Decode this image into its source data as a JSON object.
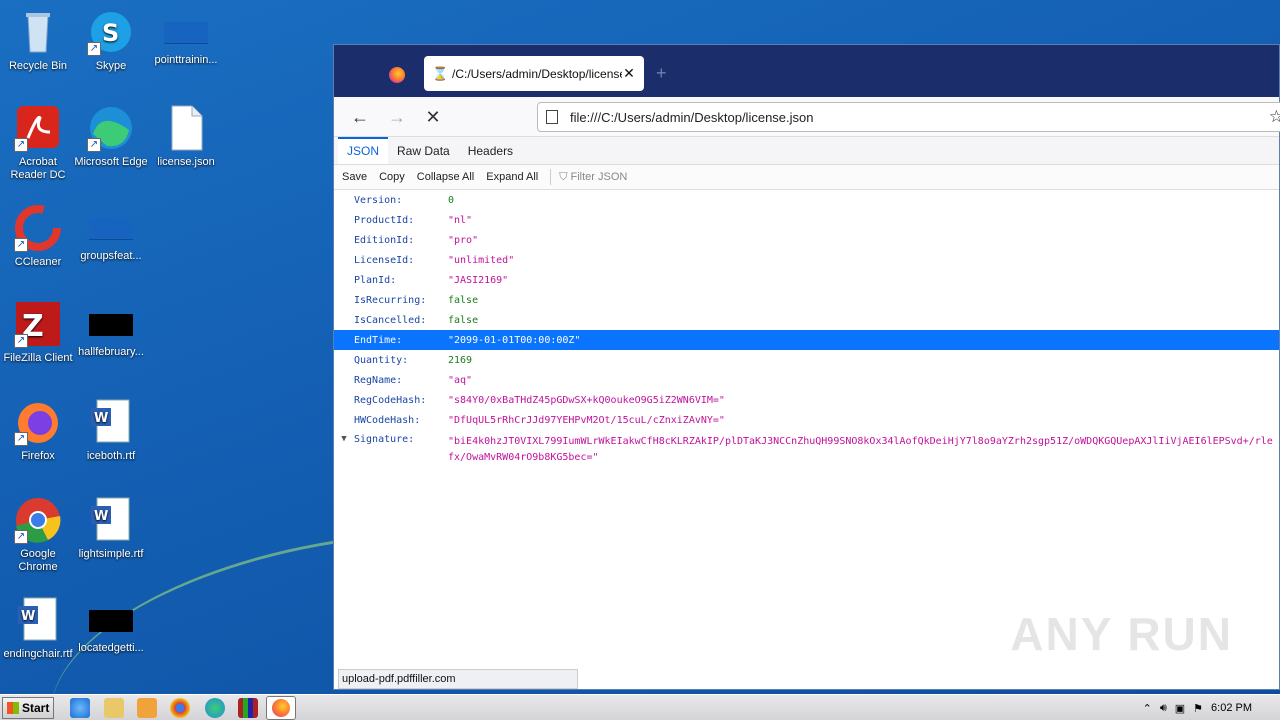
{
  "desktop": {
    "icons": [
      {
        "label": "Recycle Bin"
      },
      {
        "label": "Skype"
      },
      {
        "label": "pointtrainin..."
      },
      {
        "label": "Acrobat Reader DC"
      },
      {
        "label": "Microsoft Edge"
      },
      {
        "label": "license.json"
      },
      {
        "label": "CCleaner"
      },
      {
        "label": "groupsfeat..."
      },
      {
        "label": "FileZilla Client"
      },
      {
        "label": "hallfebruary..."
      },
      {
        "label": "Firefox"
      },
      {
        "label": "iceboth.rtf"
      },
      {
        "label": "Google Chrome"
      },
      {
        "label": "lightsimple.rtf"
      },
      {
        "label": "endingchair.rtf"
      },
      {
        "label": "locatedgetti..."
      }
    ]
  },
  "browser": {
    "tab_title": "/C:/Users/admin/Desktop/license.json",
    "url": "file:///C:/Users/admin/Desktop/license.json",
    "view_tabs": [
      "JSON",
      "Raw Data",
      "Headers"
    ],
    "toolbar": {
      "save": "Save",
      "copy": "Copy",
      "collapse_all": "Collapse All",
      "expand_all": "Expand All",
      "filter_placeholder": "Filter JSON"
    },
    "json_rows": [
      {
        "key": "Version:",
        "value": "0"
      },
      {
        "key": "ProductId:",
        "value": "\"nl\""
      },
      {
        "key": "EditionId:",
        "value": "\"pro\""
      },
      {
        "key": "LicenseId:",
        "value": "\"unlimited\""
      },
      {
        "key": "PlanId:",
        "value": "\"JASI2169\""
      },
      {
        "key": "IsRecurring:",
        "value": "false"
      },
      {
        "key": "IsCancelled:",
        "value": "false"
      },
      {
        "key": "EndTime:",
        "value": "\"2099-01-01T00:00:00Z\""
      },
      {
        "key": "Quantity:",
        "value": "2169"
      },
      {
        "key": "RegName:",
        "value": "\"aq\""
      },
      {
        "key": "RegCodeHash:",
        "value": "\"s84Y0/0xBaTHdZ45pGDwSX+kQ0oukeO9G5iZ2WN6VIM=\""
      },
      {
        "key": "HWCodeHash:",
        "value": "\"DfUqUL5rRhCrJJd97YEHPvM2Ot/15cuL/cZnxiZAvNY=\""
      },
      {
        "key": "Signature:",
        "value": "\"biE4k0hzJT0VIXL799IumWLrWkEIakwCfH8cKLRZAkIP/plDTaKJ3NCCnZhuQH99SNO8kOx34lAofQkDeiHjY7l8o9aYZrh2sgp51Z/oWDQKGQUepAXJlIiVjAEI6lEPSvd+/rlefx/OwaMvRW04rO9b8KG5bec=\""
      }
    ],
    "status_text": "upload-pdf.pdffiller.com",
    "watermark": "ANY RUN"
  },
  "taskbar": {
    "start_label": "Start",
    "clock": "6:02 PM"
  }
}
